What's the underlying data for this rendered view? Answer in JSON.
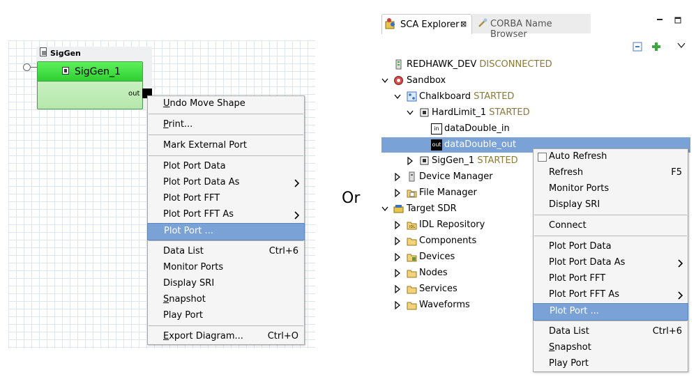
{
  "diagram": {
    "container_title": "SigGen",
    "component_name": "SigGen_1",
    "out_port_label": "out",
    "component_header_color": "#3fe03f",
    "port_color": "#000000"
  },
  "menu1": {
    "items": [
      {
        "label": "Undo Move Shape",
        "underline": "U",
        "rest": "ndo Move Shape"
      },
      {
        "label": "Print...",
        "underline": "P",
        "rest": "rint..."
      },
      {
        "label": "Mark External Port"
      },
      {
        "label": "Plot Port Data"
      },
      {
        "label": "Plot Port Data As"
      },
      {
        "label": "Plot Port FFT"
      },
      {
        "label": "Plot Port FFT As"
      },
      {
        "label": "Plot Port ..."
      },
      {
        "label": "Data List",
        "accelerator": "Ctrl+6"
      },
      {
        "label": "Monitor Ports"
      },
      {
        "label": "Display SRI"
      },
      {
        "label": "Snapshot",
        "underline": "S",
        "rest": "napshot"
      },
      {
        "label": "Play Port"
      },
      {
        "label": "Export Diagram...",
        "underline": "E",
        "rest": "xport Diagram...",
        "accelerator": "Ctrl+O"
      }
    ]
  },
  "or_text": "Or",
  "explorer": {
    "tabs": [
      {
        "label": "SCA Explorer",
        "close": "⊠"
      },
      {
        "label": "CORBA Name Browser"
      }
    ],
    "tree": {
      "redhawk_dev": {
        "label": "REDHAWK_DEV",
        "status": "DISCONNECTED"
      },
      "sandbox": {
        "label": "Sandbox"
      },
      "chalkboard": {
        "label": "Chalkboard",
        "status": "STARTED"
      },
      "hardlimit": {
        "label": "HardLimit_1",
        "status": "STARTED"
      },
      "port_in": {
        "label": "dataDouble_in",
        "badge": "in"
      },
      "port_out": {
        "label": "dataDouble_out",
        "badge": "out"
      },
      "siggen": {
        "label": "SigGen_1",
        "status": "STARTED"
      },
      "device_manager": {
        "label": "Device Manager"
      },
      "file_manager": {
        "label": "File Manager"
      },
      "target_sdr": {
        "label": "Target SDR"
      },
      "idl_repository": {
        "label": "IDL Repository"
      },
      "components": {
        "label": "Components"
      },
      "devices": {
        "label": "Devices"
      },
      "nodes": {
        "label": "Nodes"
      },
      "services": {
        "label": "Services"
      },
      "waveforms": {
        "label": "Waveforms"
      }
    },
    "selection_color": "#7aa2d6",
    "status_color": "#8a7a38"
  },
  "menu2": {
    "items": [
      {
        "label": "Auto Refresh",
        "checked": false
      },
      {
        "label": "Refresh",
        "accelerator": "F5"
      },
      {
        "label": "Monitor Ports"
      },
      {
        "label": "Display SRI"
      },
      {
        "label": "Connect"
      },
      {
        "label": "Plot Port Data"
      },
      {
        "label": "Plot Port Data As"
      },
      {
        "label": "Plot Port FFT"
      },
      {
        "label": "Plot Port FFT As"
      },
      {
        "label": "Plot Port ..."
      },
      {
        "label": "Data List",
        "accelerator": "Ctrl+6"
      },
      {
        "label": "Snapshot",
        "underline": "S",
        "rest": "napshot"
      },
      {
        "label": "Play Port"
      }
    ]
  }
}
